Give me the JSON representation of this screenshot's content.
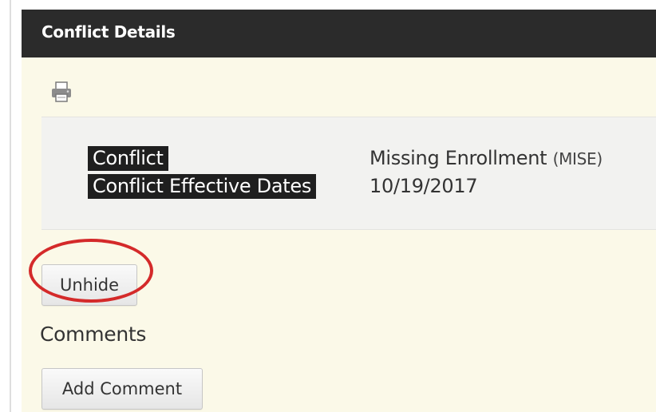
{
  "panel": {
    "title": "Conflict Details"
  },
  "toolbar": {
    "print_icon": "printer-icon"
  },
  "details": {
    "rows": [
      {
        "label": "Conflict",
        "value": "Missing Enrollment",
        "code": "(MISE)"
      },
      {
        "label": "Conflict Effective Dates",
        "value": "10/19/2017"
      }
    ]
  },
  "actions": {
    "unhide_label": "Unhide"
  },
  "comments": {
    "title": "Comments",
    "add_label": "Add Comment"
  },
  "colors": {
    "header_bg": "#2b2b2b",
    "panel_bg": "#fbf9e8",
    "details_bg": "#f2f2f0",
    "highlight_ring": "#d42a2a"
  }
}
